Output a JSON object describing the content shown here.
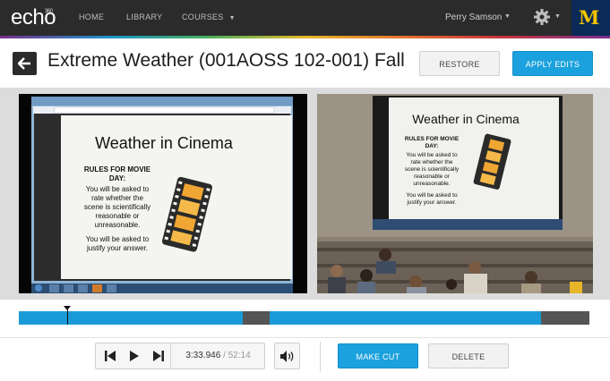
{
  "nav": {
    "logo": "echo",
    "logo_sup": "360",
    "items": [
      {
        "label": "HOME"
      },
      {
        "label": "LIBRARY"
      },
      {
        "label": "COURSES"
      }
    ],
    "user": "Perry Samson",
    "brand_mark": "M",
    "icons": [
      "gear-icon",
      "chevron-down-icon"
    ]
  },
  "header": {
    "title": "Extreme Weather (001AOSS 102-001) Fall",
    "restore_label": "RESTORE",
    "apply_label": "APPLY EDITS"
  },
  "slide": {
    "title": "Weather in Cinema",
    "rules_heading_1": "RULES FOR MOVIE",
    "rules_heading_2": "DAY:",
    "line1": "You will be asked to",
    "line2": "rate whether the",
    "line3": "scene is scientifically",
    "line4": "reasonable or",
    "line5": "unreasonable.",
    "line6": "You will be asked to",
    "line7": "justify your answer."
  },
  "player": {
    "current_time": "3:33.946",
    "separator": "/",
    "total_time": "52:14",
    "make_cut_label": "MAKE CUT",
    "delete_label": "DELETE"
  },
  "timeline": {
    "playhead_fraction": 0.085,
    "segments": [
      {
        "start": 0.0,
        "end": 0.393,
        "state": "kept"
      },
      {
        "start": 0.393,
        "end": 0.44,
        "state": "cut"
      },
      {
        "start": 0.44,
        "end": 0.915,
        "state": "kept"
      },
      {
        "start": 0.915,
        "end": 1.0,
        "state": "cut"
      }
    ]
  },
  "colors": {
    "accent": "#1ba1dd",
    "kept_segment": "#1a9bd7",
    "cut_segment": "#555555",
    "nav_bg": "#2b2b2b",
    "brand_blue": "#0b2a57",
    "brand_maize": "#f2c400"
  }
}
